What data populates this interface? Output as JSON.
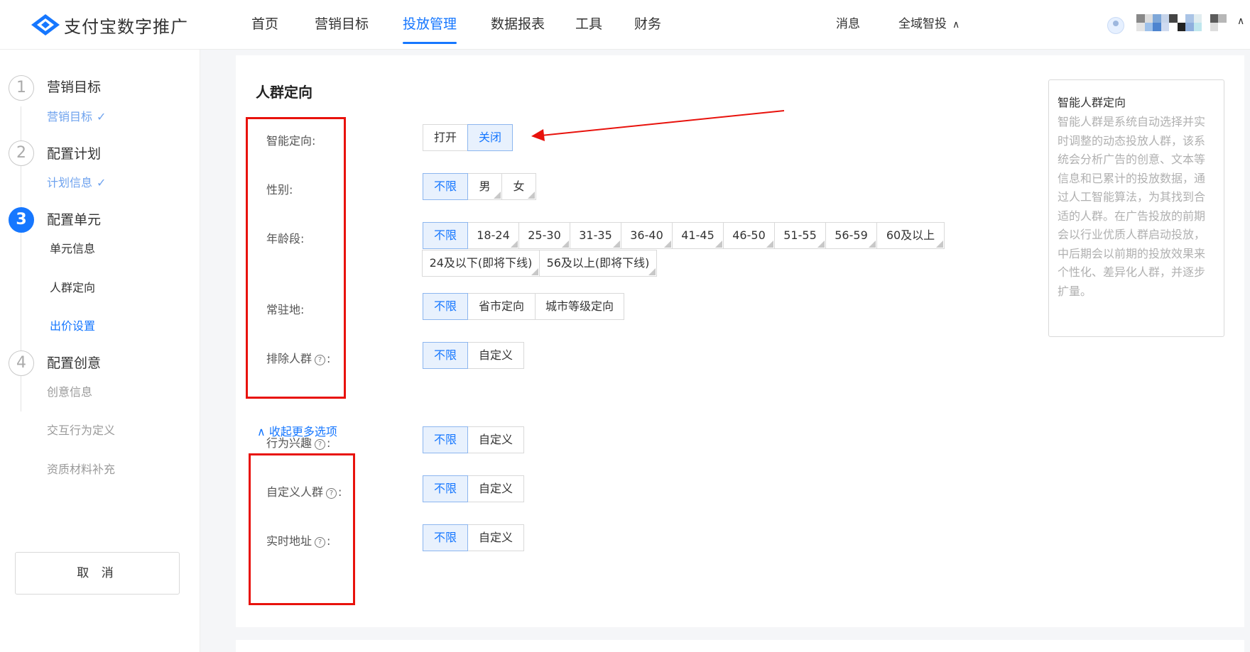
{
  "brand": {
    "name": "支付宝数字推广",
    "accent": "#1677ff"
  },
  "nav": {
    "items": [
      "首页",
      "营销目标",
      "投放管理",
      "数据报表",
      "工具",
      "财务"
    ],
    "active_index": 2
  },
  "top_right": {
    "messages": "消息",
    "scope": "全域智投"
  },
  "sidebar": {
    "steps": [
      {
        "num": "1",
        "title": "营销目标",
        "subs": [
          {
            "label": "营销目标",
            "state": "done"
          }
        ]
      },
      {
        "num": "2",
        "title": "配置计划",
        "subs": [
          {
            "label": "计划信息",
            "state": "done"
          }
        ]
      },
      {
        "num": "3",
        "title": "配置单元",
        "subs": [
          {
            "label": "单元信息",
            "state": "normal"
          },
          {
            "label": "人群定向",
            "state": "normal"
          },
          {
            "label": "出价设置",
            "state": "link"
          }
        ]
      },
      {
        "num": "4",
        "title": "配置创意",
        "subs": [
          {
            "label": "创意信息",
            "state": "pending"
          },
          {
            "label": "交互行为定义",
            "state": "pending"
          },
          {
            "label": "资质材料补充",
            "state": "pending"
          }
        ]
      }
    ],
    "active_step": 3,
    "cancel": "取 消"
  },
  "section": {
    "title": "人群定向"
  },
  "rows": {
    "smart": {
      "label": "智能定向:",
      "options": [
        "打开",
        "关闭"
      ],
      "selected": "关闭"
    },
    "gender": {
      "label": "性别:",
      "options": [
        "不限",
        "男",
        "女"
      ],
      "selected": "不限"
    },
    "age": {
      "label": "年龄段:",
      "options": [
        "不限",
        "18-24",
        "25-30",
        "31-35",
        "36-40",
        "41-45",
        "46-50",
        "51-55",
        "56-59",
        "60及以上"
      ],
      "options_row2": [
        "24及以下(即将下线)",
        "56及以上(即将下线)"
      ],
      "selected": "不限"
    },
    "residence": {
      "label": "常驻地:",
      "options": [
        "不限",
        "省市定向",
        "城市等级定向"
      ],
      "selected": "不限"
    },
    "exclude": {
      "label": "排除人群",
      "options": [
        "不限",
        "自定义"
      ],
      "selected": "不限"
    },
    "interest": {
      "label": "行为兴趣",
      "options": [
        "不限",
        "自定义"
      ],
      "selected": "不限"
    },
    "custom": {
      "label": "自定义人群",
      "options": [
        "不限",
        "自定义"
      ],
      "selected": "不限"
    },
    "realtime": {
      "label": "实时地址",
      "options": [
        "不限",
        "自定义"
      ],
      "selected": "不限"
    }
  },
  "collapse_link": "收起更多选项",
  "help": {
    "title": "智能人群定向",
    "body": "智能人群是系统自动选择并实时调整的动态投放人群，该系统会分析广告的创意、文本等信息和已累计的投放数据，通过人工智能算法，为其找到合适的人群。在广告投放的前期会以行业优质人群启动投放，中后期会以前期的投放效果来个性化、差异化人群，并逐步扩量。"
  },
  "annotation_color": "#e8120c"
}
